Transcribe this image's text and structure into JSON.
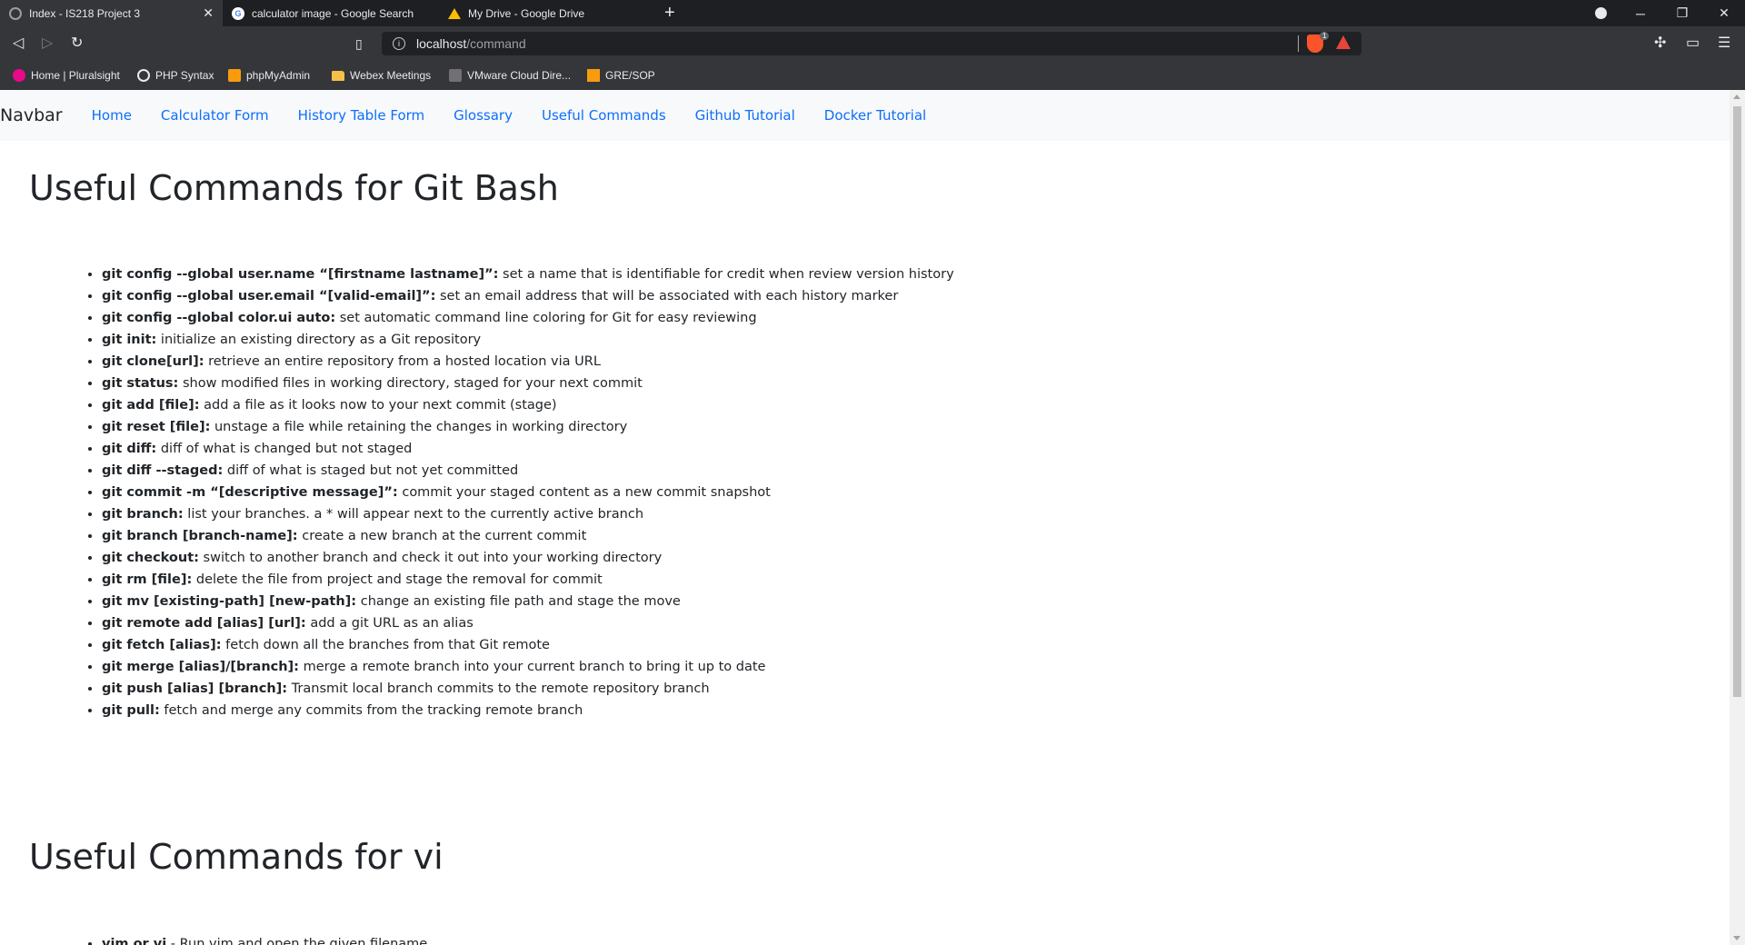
{
  "browser": {
    "tabs": [
      {
        "title": "Index - IS218 Project 3",
        "active": true
      },
      {
        "title": "calculator image - Google Search",
        "active": false
      },
      {
        "title": "My Drive - Google Drive",
        "active": false
      }
    ],
    "new_tab_label": "+",
    "url_host": "localhost",
    "url_path": "/command",
    "shields_count": "1",
    "bookmarks": [
      {
        "label": "Home | Pluralsight",
        "icon": "pluralsight-icon",
        "color": "#e80a89"
      },
      {
        "label": "PHP Syntax",
        "icon": "globe-icon",
        "color": "#e8eaed"
      },
      {
        "label": "phpMyAdmin",
        "icon": "phpmyadmin-icon",
        "color": "#f89c0e"
      },
      {
        "label": "Webex Meetings",
        "icon": "folder-icon",
        "color": "#f5c04a"
      },
      {
        "label": "VMware Cloud Dire...",
        "icon": "vmware-icon",
        "color": "#717074"
      },
      {
        "label": "GRE/SOP",
        "icon": "bookmark-icon",
        "color": "#f89c0e"
      }
    ]
  },
  "navbar": {
    "brand": "Navbar",
    "links": [
      "Home",
      "Calculator Form",
      "History Table Form",
      "Glossary",
      "Useful Commands",
      "Github Tutorial",
      "Docker Tutorial"
    ]
  },
  "sections": [
    {
      "title": "Useful Commands for Git Bash",
      "commands": [
        {
          "cmd": "git config --global user.name “[firstname lastname]”:",
          "desc": " set a name that is identifiable for credit when review version history"
        },
        {
          "cmd": "git config --global user.email “[valid-email]”:",
          "desc": " set an email address that will be associated with each history marker"
        },
        {
          "cmd": "git config --global color.ui auto:",
          "desc": " set automatic command line coloring for Git for easy reviewing"
        },
        {
          "cmd": "git init:",
          "desc": " initialize an existing directory as a Git repository"
        },
        {
          "cmd": "git clone[url]:",
          "desc": " retrieve an entire repository from a hosted location via URL"
        },
        {
          "cmd": "git status:",
          "desc": " show modified files in working directory, staged for your next commit"
        },
        {
          "cmd": "git add [file]:",
          "desc": " add a file as it looks now to your next commit (stage)"
        },
        {
          "cmd": "git reset [file]:",
          "desc": " unstage a file while retaining the changes in working directory"
        },
        {
          "cmd": "git diff:",
          "desc": " diff of what is changed but not staged"
        },
        {
          "cmd": "git diff --staged:",
          "desc": " diff of what is staged but not yet committed"
        },
        {
          "cmd": "git commit -m “[descriptive message]”:",
          "desc": " commit your staged content as a new commit snapshot"
        },
        {
          "cmd": "git branch:",
          "desc": " list your branches. a * will appear next to the currently active branch"
        },
        {
          "cmd": "git branch [branch-name]:",
          "desc": " create a new branch at the current commit"
        },
        {
          "cmd": "git checkout:",
          "desc": " switch to another branch and check it out into your working directory"
        },
        {
          "cmd": "git rm [file]:",
          "desc": " delete the file from project and stage the removal for commit"
        },
        {
          "cmd": "git mv [existing-path] [new-path]:",
          "desc": " change an existing file path and stage the move"
        },
        {
          "cmd": "git remote add [alias] [url]:",
          "desc": " add a git URL as an alias"
        },
        {
          "cmd": "git fetch [alias]:",
          "desc": " fetch down all the branches from that Git remote"
        },
        {
          "cmd": "git merge [alias]/[branch]:",
          "desc": " merge a remote branch into your current branch to bring it up to date"
        },
        {
          "cmd": "git push [alias] [branch]:",
          "desc": " Transmit local branch commits to the remote repository branch"
        },
        {
          "cmd": "git pull:",
          "desc": " fetch and merge any commits from the tracking remote branch"
        }
      ]
    },
    {
      "title": "Useful Commands for vi",
      "commands": [
        {
          "cmd": "vim or vi",
          "desc": " - Run vim and open the given filename"
        }
      ]
    }
  ]
}
